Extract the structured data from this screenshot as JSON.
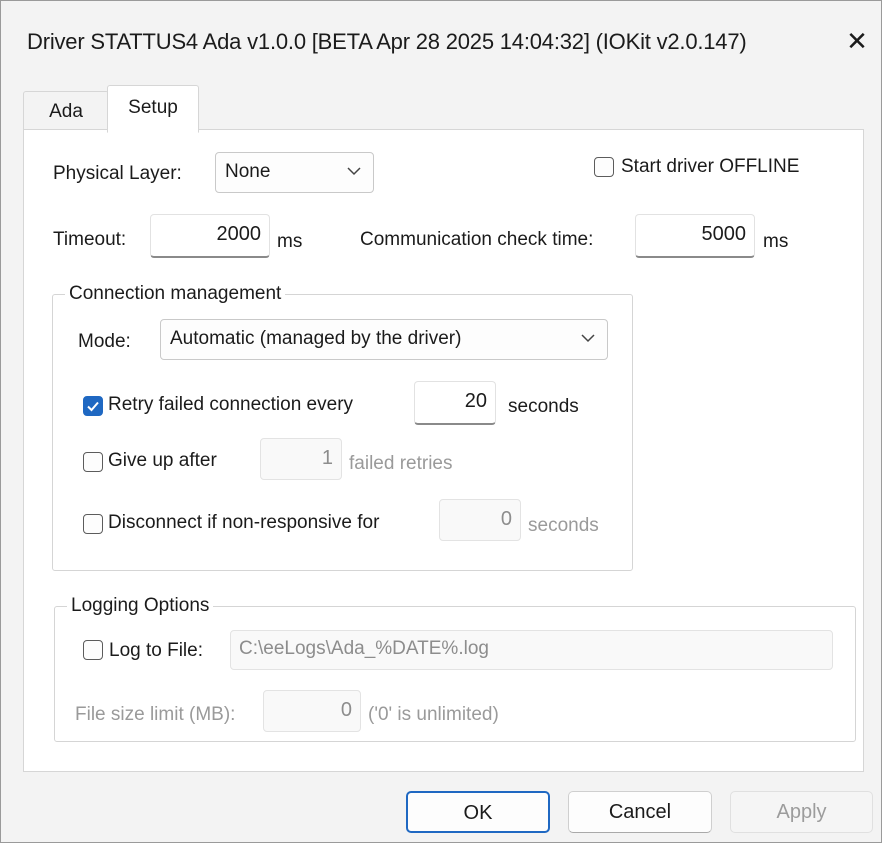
{
  "window": {
    "title": "Driver STATTUS4 Ada v1.0.0 [BETA Apr 28 2025 14:04:32] (IOKit v2.0.147)",
    "close_glyph": "✕"
  },
  "tabs": [
    {
      "label": "Ada",
      "active": false
    },
    {
      "label": "Setup",
      "active": true
    }
  ],
  "setup": {
    "physical_layer_label": "Physical Layer:",
    "physical_layer_value": "None",
    "start_offline_label": "Start driver OFFLINE",
    "start_offline_checked": false,
    "timeout_label": "Timeout:",
    "timeout_value": "2000",
    "timeout_unit": "ms",
    "comm_check_label": "Communication check time:",
    "comm_check_value": "5000",
    "comm_check_unit": "ms"
  },
  "connection": {
    "group_title": "Connection management",
    "mode_label": "Mode:",
    "mode_value": "Automatic (managed by the driver)",
    "retry_label": "Retry failed connection every",
    "retry_checked": true,
    "retry_value": "20",
    "retry_unit": "seconds",
    "giveup_label": "Give up after",
    "giveup_checked": false,
    "giveup_value": "1",
    "giveup_unit": "failed retries",
    "disconnect_label": "Disconnect if non-responsive for",
    "disconnect_checked": false,
    "disconnect_value": "0",
    "disconnect_unit": "seconds"
  },
  "logging": {
    "group_title": "Logging Options",
    "log_to_file_label": "Log to File:",
    "log_to_file_checked": false,
    "log_path_value": "C:\\eeLogs\\Ada_%DATE%.log",
    "size_limit_label": "File size limit (MB):",
    "size_limit_value": "0",
    "size_limit_note": "('0' is unlimited)"
  },
  "buttons": {
    "ok": "OK",
    "cancel": "Cancel",
    "apply": "Apply"
  },
  "colors": {
    "accent": "#1f68c2",
    "window_bg": "#f3f3f3",
    "panel_bg": "#ffffff",
    "disabled_text": "#9a9a9a"
  },
  "icons": {
    "close": "close-icon",
    "dropdown": "chevron-down-icon",
    "checkbox_check": "checkmark-icon"
  }
}
